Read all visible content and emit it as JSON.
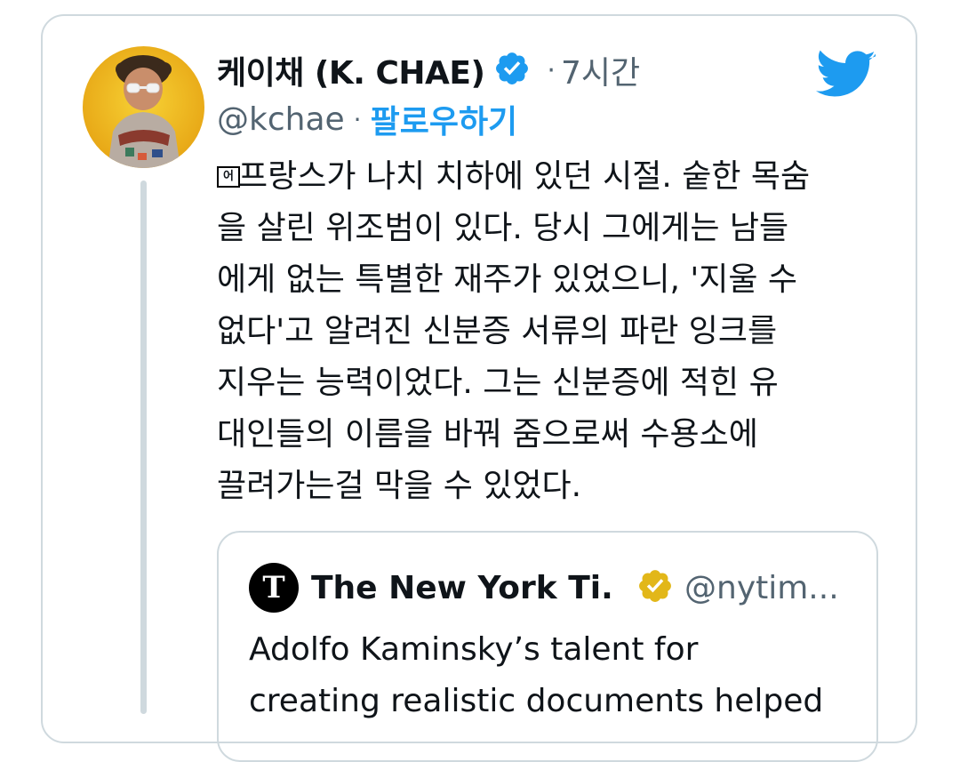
{
  "colors": {
    "accent": "#1d9bf0",
    "verified_blue": "#1d9bf0",
    "verified_gold": "#e2b719",
    "secondary_text": "#536471",
    "border": "#cfd9de"
  },
  "tweet": {
    "author_name": "케이채 (K. CHAE)",
    "verified_icon": "verified-badge-blue",
    "separator": "·",
    "time": "7시간",
    "handle": "@kchae",
    "follow_label": "팔로우하기",
    "brand_icon": "twitter-bird-icon",
    "flag_emoji_label": "어",
    "text": "프랑스가 나치 치하에 있던 시절. 숱한 목숨\n을 살린 위조범이 있다. 당시 그에게는 남들\n에게 없는 특별한 재주가 있었으니, '지울 수\n없다'고 알려진 신분증 서류의 파란 잉크를\n지우는 능력이었다. 그는 신분증에 적힌 유\n대인들의 이름을 바꿔 줌으로써 수용소에\n끌려가는걸 막을 수 있었다."
  },
  "quoted_tweet": {
    "author_name": "The New York Ti...",
    "verified_icon": "verified-badge-gold",
    "handle": "@nytim...",
    "text": "Adolfo Kaminsky’s talent for\ncreating realistic documents helped"
  }
}
